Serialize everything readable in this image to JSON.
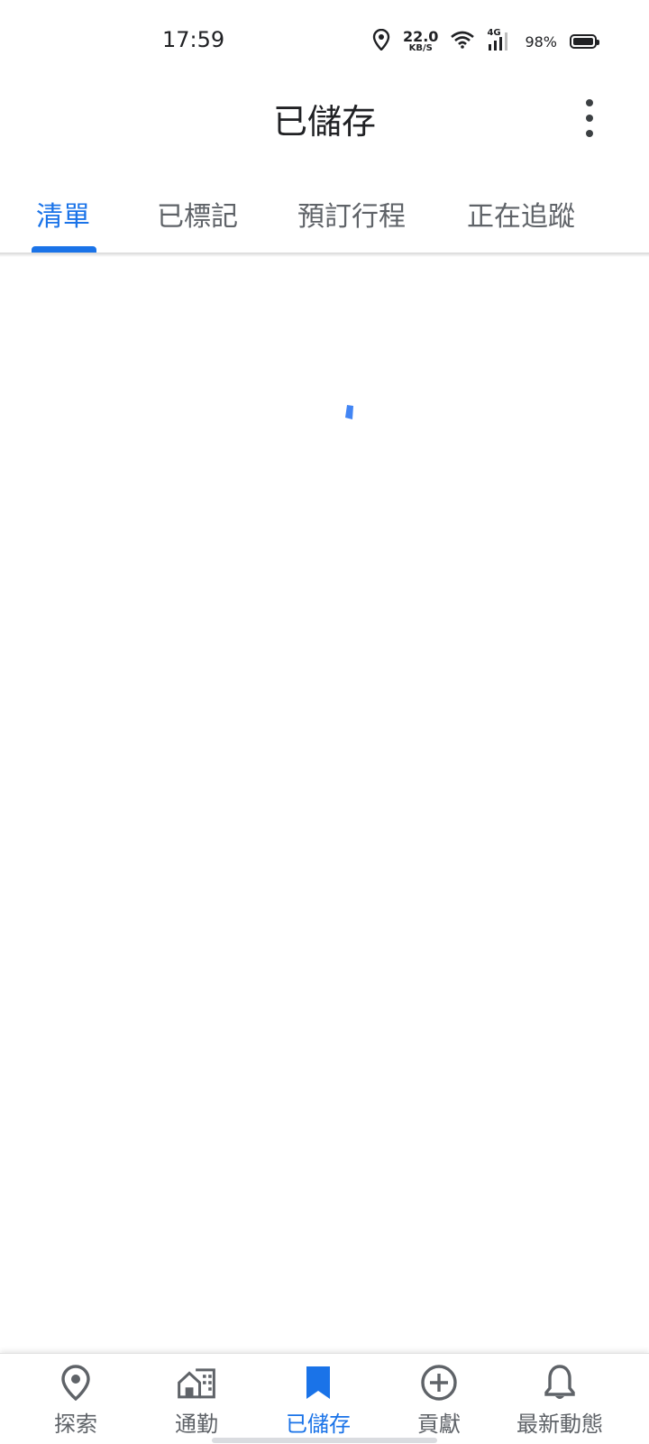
{
  "status_bar": {
    "time": "17:59",
    "net_speed_value": "22.0",
    "net_speed_unit": "KB/S",
    "network_type": "4G",
    "battery_percent": "98%"
  },
  "app_bar": {
    "title": "已儲存",
    "more_icon": "more-vert-icon"
  },
  "tabs": [
    {
      "label": "清單",
      "active": true
    },
    {
      "label": "已標記",
      "active": false
    },
    {
      "label": "預訂行程",
      "active": false
    },
    {
      "label": "正在追蹤",
      "active": false
    }
  ],
  "loading_indicator_color": "#4285f4",
  "bottom_nav": [
    {
      "label": "探索",
      "icon": "location-pin-icon",
      "active": false
    },
    {
      "label": "通勤",
      "icon": "commute-home-icon",
      "active": false
    },
    {
      "label": "已儲存",
      "icon": "bookmark-icon",
      "active": true
    },
    {
      "label": "貢獻",
      "icon": "add-circle-icon",
      "active": false
    },
    {
      "label": "最新動態",
      "icon": "bell-icon",
      "active": false
    }
  ],
  "colors": {
    "accent": "#1a73e8",
    "inactive": "#5f6368"
  }
}
